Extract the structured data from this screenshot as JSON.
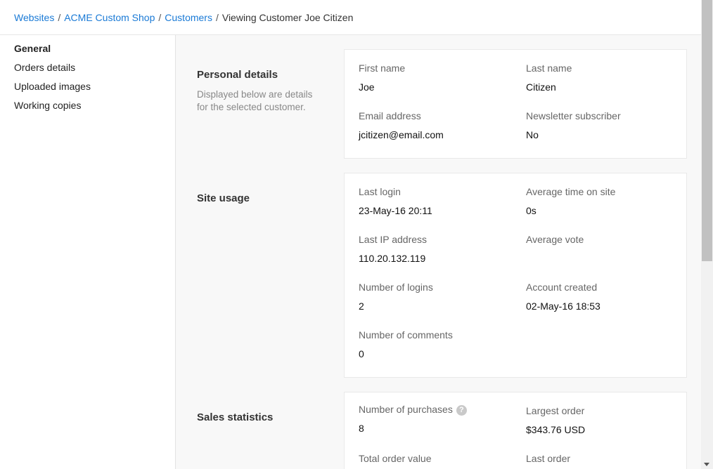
{
  "breadcrumb": {
    "items": [
      "Websites",
      "ACME Custom Shop",
      "Customers"
    ],
    "separator": "/",
    "current": "Viewing Customer Joe Citizen"
  },
  "sidebar": {
    "items": [
      {
        "label": "General",
        "active": true
      },
      {
        "label": "Orders details",
        "active": false
      },
      {
        "label": "Uploaded images",
        "active": false
      },
      {
        "label": "Working copies",
        "active": false
      }
    ]
  },
  "personal": {
    "title": "Personal details",
    "description": "Displayed below are details for the selected customer.",
    "first_name_label": "First name",
    "first_name": "Joe",
    "last_name_label": "Last name",
    "last_name": "Citizen",
    "email_label": "Email address",
    "email": "jcitizen@email.com",
    "newsletter_label": "Newsletter subscriber",
    "newsletter": "No"
  },
  "usage": {
    "title": "Site usage",
    "last_login_label": "Last login",
    "last_login": "23-May-16 20:11",
    "avg_time_label": "Average time on site",
    "avg_time": "0s",
    "last_ip_label": "Last IP address",
    "last_ip": "110.20.132.119",
    "avg_vote_label": "Average vote",
    "avg_vote": "",
    "logins_label": "Number of logins",
    "logins": "2",
    "created_label": "Account created",
    "created": "02-May-16 18:53",
    "comments_label": "Number of comments",
    "comments": "0"
  },
  "sales": {
    "title": "Sales statistics",
    "purchases_label": "Number of purchases",
    "help_glyph": "?",
    "purchases": "8",
    "largest_label": "Largest order",
    "largest": "$343.76 USD",
    "total_label": "Total order value",
    "last_order_label": "Last order"
  },
  "colors": {
    "link": "#1a7ad6",
    "content_bg": "#f8f8f8",
    "card_bg": "#ffffff"
  }
}
